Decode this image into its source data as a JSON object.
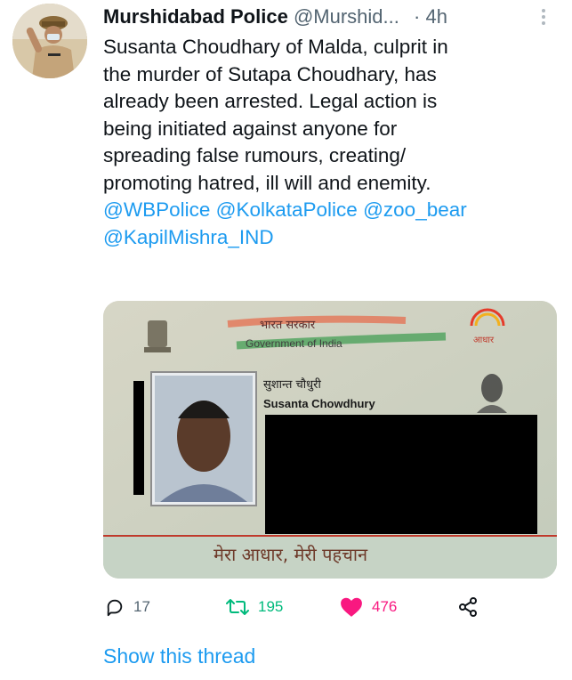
{
  "author": {
    "name": "Murshidabad Police",
    "handle": "@Murshid...",
    "separator": "·",
    "time": "4h"
  },
  "tweet": {
    "lines": [
      "Susanta Choudhary of Malda, culprit in",
      "the murder of Sutapa Choudhary, has",
      "already been arrested. Legal action is",
      "being initiated against anyone for",
      "spreading false rumours, creating/",
      "promoting hatred, ill will and enemity."
    ],
    "mentions": [
      "@WBPolice",
      "@KolkataPolice",
      "@zoo_bear",
      "@KapilMishra_IND"
    ]
  },
  "card": {
    "hindi_header": "भारत सरकार",
    "english_header": "Government of India",
    "aadhaar_label": "आधार",
    "name_hindi": "सुशान्त चौधुरी",
    "name_english": "Susanta Chowdhury",
    "footer_slogan": "मेरा आधार, मेरी पहचान"
  },
  "actions": {
    "reply_count": "17",
    "retweet_count": "195",
    "like_count": "476"
  },
  "show_thread": "Show this thread",
  "colors": {
    "link": "#1d9bf0",
    "retweet": "#00ba7c",
    "like": "#f91880",
    "muted": "#536471"
  }
}
